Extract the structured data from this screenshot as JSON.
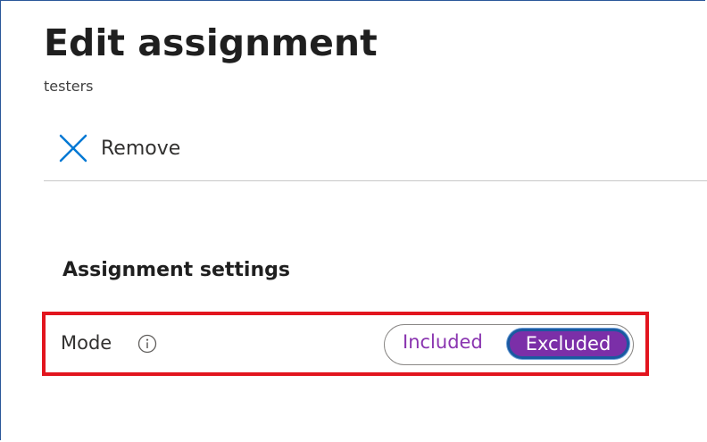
{
  "page": {
    "title": "Edit assignment",
    "subtitle": "testers"
  },
  "toolbar": {
    "remove_label": "Remove",
    "remove_icon": "close-x-icon"
  },
  "settings": {
    "section_title": "Assignment settings",
    "mode_label": "Mode",
    "info_icon": "info-icon",
    "mode_options": [
      "Included",
      "Excluded"
    ],
    "selected": "Excluded"
  },
  "colors": {
    "accent_blue": "#0078d4",
    "toggle_text": "#8a35b0",
    "selected_fill": "#7b2fa8",
    "highlight_red": "#e2151e"
  }
}
